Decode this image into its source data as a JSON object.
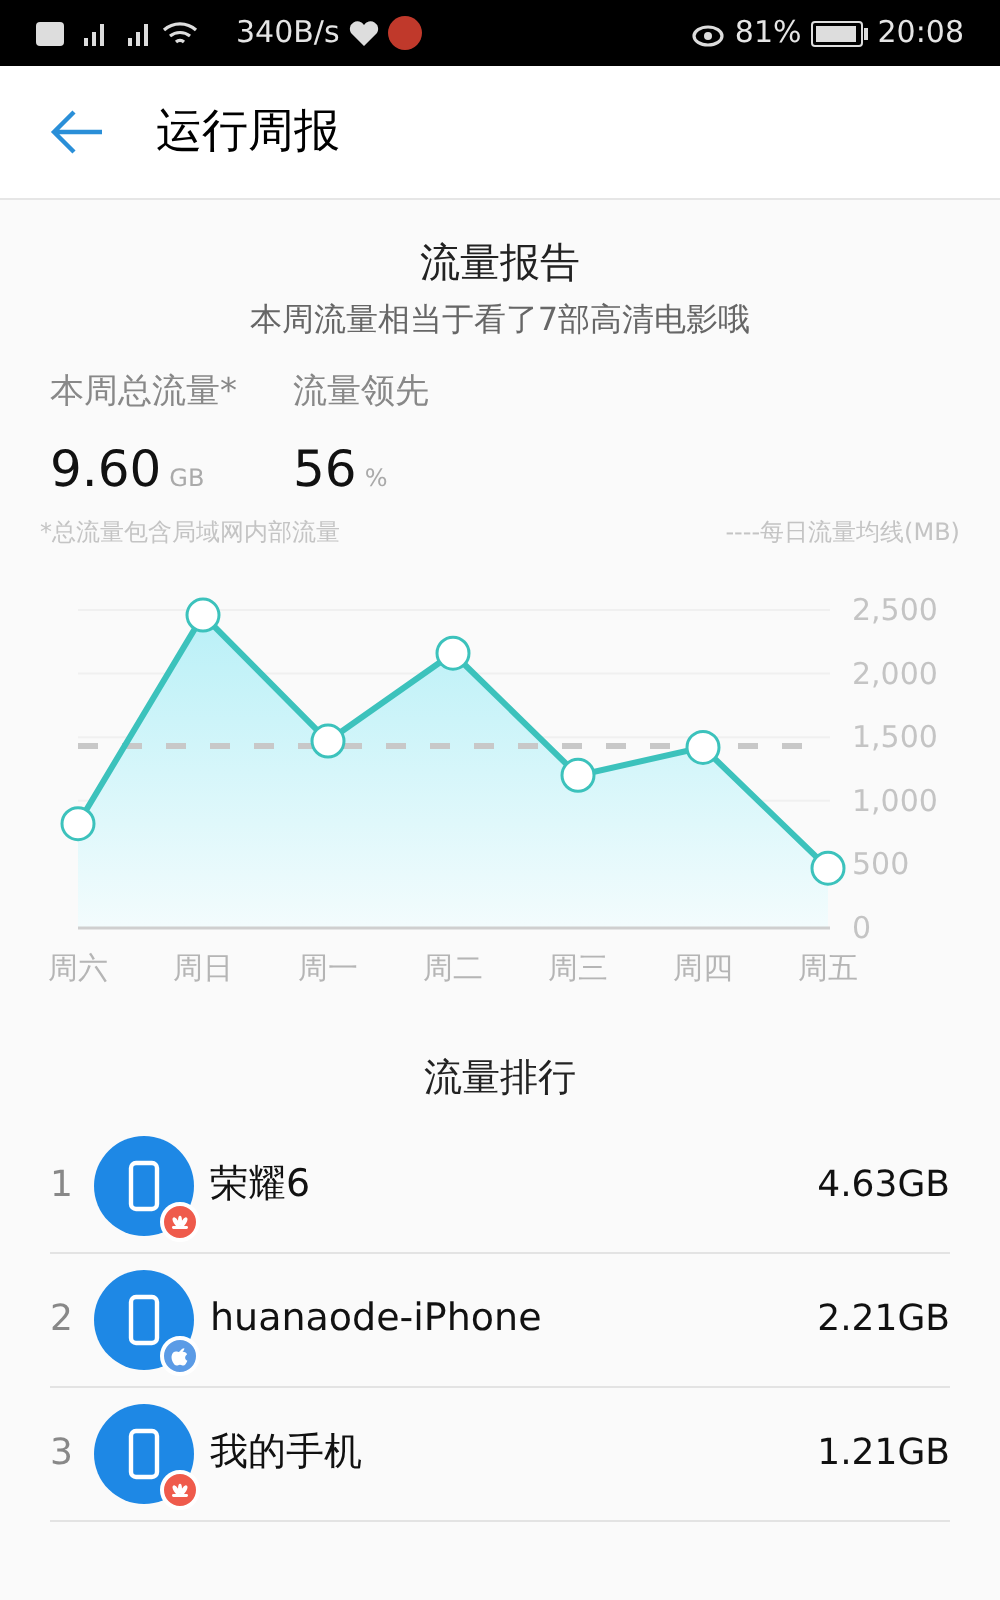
{
  "status_bar": {
    "speed": "340B/s",
    "battery": "81%",
    "time": "20:08"
  },
  "header": {
    "title": "运行周报"
  },
  "report": {
    "title": "流量报告",
    "subtitle": "本周流量相当于看了7部高清电影哦",
    "stats": [
      {
        "label": "本周总流量*",
        "value": "9.60",
        "unit": "GB"
      },
      {
        "label": "流量领先",
        "value": "56",
        "unit": "%"
      }
    ],
    "footnote": "*总流量包含局域网内部流量",
    "legend": "----每日流量均线(MB)",
    "chart_data": {
      "type": "area",
      "categories": [
        "周六",
        "周日",
        "周一",
        "周二",
        "周三",
        "周四",
        "周五"
      ],
      "series": [
        {
          "color": "#3cc2bc",
          "values": [
            820,
            2460,
            1470,
            2160,
            1200,
            1420,
            470
          ]
        }
      ],
      "grid": true,
      "ylim": [
        0,
        2500
      ],
      "yticks": [
        {
          "value": 0,
          "label": "0"
        },
        {
          "value": 500,
          "label": "500"
        },
        {
          "value": 1000,
          "label": "1,000"
        },
        {
          "value": 1500,
          "label": "1,500"
        },
        {
          "value": 2000,
          "label": "2,000"
        },
        {
          "value": 2500,
          "label": "2,500"
        }
      ],
      "ref_lines": [
        {
          "axis": "y",
          "value": 1430
        }
      ]
    }
  },
  "ranking": {
    "title": "流量排行",
    "rows": [
      {
        "rank": "1",
        "name": "荣耀6",
        "usage": "4.63GB",
        "kind": "huawei"
      },
      {
        "rank": "2",
        "name": "huanaode-iPhone",
        "usage": "2.21GB",
        "kind": "apple"
      },
      {
        "rank": "3",
        "name": "我的手机",
        "usage": "1.21GB",
        "kind": "huawei"
      }
    ]
  }
}
